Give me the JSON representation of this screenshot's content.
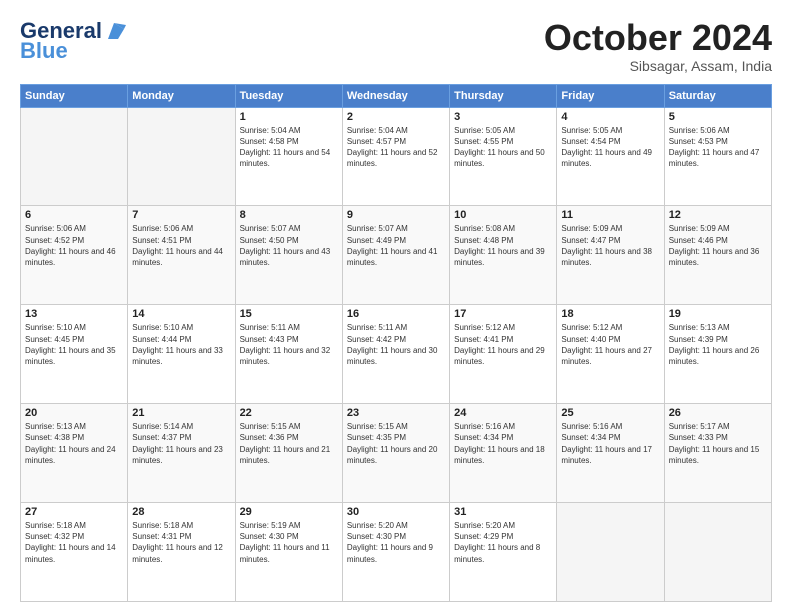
{
  "header": {
    "logo_general": "General",
    "logo_blue": "Blue",
    "month": "October 2024",
    "location": "Sibsagar, Assam, India"
  },
  "weekdays": [
    "Sunday",
    "Monday",
    "Tuesday",
    "Wednesday",
    "Thursday",
    "Friday",
    "Saturday"
  ],
  "weeks": [
    [
      {
        "day": "",
        "empty": true
      },
      {
        "day": "",
        "empty": true
      },
      {
        "day": "1",
        "sunrise": "5:04 AM",
        "sunset": "4:58 PM",
        "daylight": "11 hours and 54 minutes."
      },
      {
        "day": "2",
        "sunrise": "5:04 AM",
        "sunset": "4:57 PM",
        "daylight": "11 hours and 52 minutes."
      },
      {
        "day": "3",
        "sunrise": "5:05 AM",
        "sunset": "4:55 PM",
        "daylight": "11 hours and 50 minutes."
      },
      {
        "day": "4",
        "sunrise": "5:05 AM",
        "sunset": "4:54 PM",
        "daylight": "11 hours and 49 minutes."
      },
      {
        "day": "5",
        "sunrise": "5:06 AM",
        "sunset": "4:53 PM",
        "daylight": "11 hours and 47 minutes."
      }
    ],
    [
      {
        "day": "6",
        "sunrise": "5:06 AM",
        "sunset": "4:52 PM",
        "daylight": "11 hours and 46 minutes."
      },
      {
        "day": "7",
        "sunrise": "5:06 AM",
        "sunset": "4:51 PM",
        "daylight": "11 hours and 44 minutes."
      },
      {
        "day": "8",
        "sunrise": "5:07 AM",
        "sunset": "4:50 PM",
        "daylight": "11 hours and 43 minutes."
      },
      {
        "day": "9",
        "sunrise": "5:07 AM",
        "sunset": "4:49 PM",
        "daylight": "11 hours and 41 minutes."
      },
      {
        "day": "10",
        "sunrise": "5:08 AM",
        "sunset": "4:48 PM",
        "daylight": "11 hours and 39 minutes."
      },
      {
        "day": "11",
        "sunrise": "5:09 AM",
        "sunset": "4:47 PM",
        "daylight": "11 hours and 38 minutes."
      },
      {
        "day": "12",
        "sunrise": "5:09 AM",
        "sunset": "4:46 PM",
        "daylight": "11 hours and 36 minutes."
      }
    ],
    [
      {
        "day": "13",
        "sunrise": "5:10 AM",
        "sunset": "4:45 PM",
        "daylight": "11 hours and 35 minutes."
      },
      {
        "day": "14",
        "sunrise": "5:10 AM",
        "sunset": "4:44 PM",
        "daylight": "11 hours and 33 minutes."
      },
      {
        "day": "15",
        "sunrise": "5:11 AM",
        "sunset": "4:43 PM",
        "daylight": "11 hours and 32 minutes."
      },
      {
        "day": "16",
        "sunrise": "5:11 AM",
        "sunset": "4:42 PM",
        "daylight": "11 hours and 30 minutes."
      },
      {
        "day": "17",
        "sunrise": "5:12 AM",
        "sunset": "4:41 PM",
        "daylight": "11 hours and 29 minutes."
      },
      {
        "day": "18",
        "sunrise": "5:12 AM",
        "sunset": "4:40 PM",
        "daylight": "11 hours and 27 minutes."
      },
      {
        "day": "19",
        "sunrise": "5:13 AM",
        "sunset": "4:39 PM",
        "daylight": "11 hours and 26 minutes."
      }
    ],
    [
      {
        "day": "20",
        "sunrise": "5:13 AM",
        "sunset": "4:38 PM",
        "daylight": "11 hours and 24 minutes."
      },
      {
        "day": "21",
        "sunrise": "5:14 AM",
        "sunset": "4:37 PM",
        "daylight": "11 hours and 23 minutes."
      },
      {
        "day": "22",
        "sunrise": "5:15 AM",
        "sunset": "4:36 PM",
        "daylight": "11 hours and 21 minutes."
      },
      {
        "day": "23",
        "sunrise": "5:15 AM",
        "sunset": "4:35 PM",
        "daylight": "11 hours and 20 minutes."
      },
      {
        "day": "24",
        "sunrise": "5:16 AM",
        "sunset": "4:34 PM",
        "daylight": "11 hours and 18 minutes."
      },
      {
        "day": "25",
        "sunrise": "5:16 AM",
        "sunset": "4:34 PM",
        "daylight": "11 hours and 17 minutes."
      },
      {
        "day": "26",
        "sunrise": "5:17 AM",
        "sunset": "4:33 PM",
        "daylight": "11 hours and 15 minutes."
      }
    ],
    [
      {
        "day": "27",
        "sunrise": "5:18 AM",
        "sunset": "4:32 PM",
        "daylight": "11 hours and 14 minutes."
      },
      {
        "day": "28",
        "sunrise": "5:18 AM",
        "sunset": "4:31 PM",
        "daylight": "11 hours and 12 minutes."
      },
      {
        "day": "29",
        "sunrise": "5:19 AM",
        "sunset": "4:30 PM",
        "daylight": "11 hours and 11 minutes."
      },
      {
        "day": "30",
        "sunrise": "5:20 AM",
        "sunset": "4:30 PM",
        "daylight": "11 hours and 9 minutes."
      },
      {
        "day": "31",
        "sunrise": "5:20 AM",
        "sunset": "4:29 PM",
        "daylight": "11 hours and 8 minutes."
      },
      {
        "day": "",
        "empty": true
      },
      {
        "day": "",
        "empty": true
      }
    ]
  ]
}
